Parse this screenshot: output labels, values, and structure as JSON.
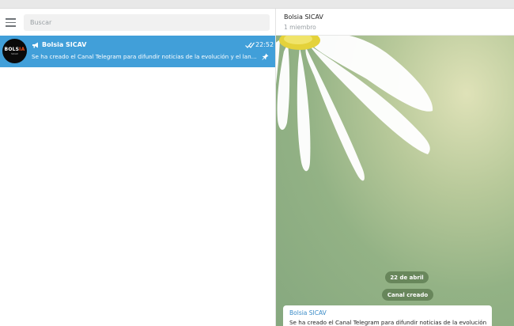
{
  "search": {
    "placeholder": "Buscar"
  },
  "chat_list": {
    "items": [
      {
        "avatar_text_main": "BOLS",
        "avatar_text_accent": "IA",
        "avatar_text_sub": "SICAV",
        "name": "Bolsia SICAV",
        "time": "22:52",
        "preview": "Se ha creado el Canal Telegram para difundir noticias de la evolución y el lanzamiento de la SICAV",
        "icons": [
          "megaphone-icon",
          "double-check-icon",
          "pin-icon"
        ]
      }
    ]
  },
  "conversation": {
    "title": "Bolsia SICAV",
    "subtitle": "1 miembro",
    "date_pill": "22 de abril",
    "service_message": "Canal creado",
    "message": {
      "author": "Bolsia SICAV",
      "text": "Se ha creado el Canal Telegram para difundir noticias de la evolución"
    }
  },
  "colors": {
    "accent": "#419fd9",
    "author": "#3a8bc7",
    "wallpaper": "#93b285"
  }
}
